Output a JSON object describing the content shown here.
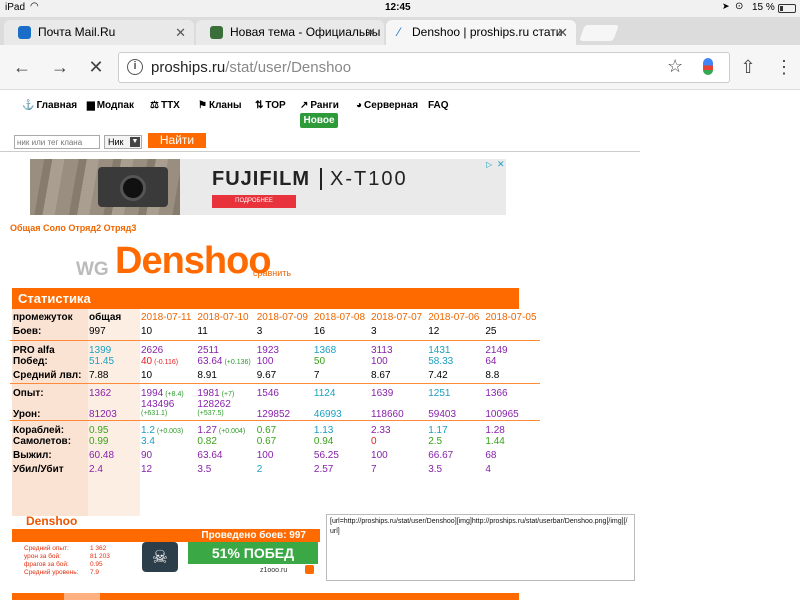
{
  "status": {
    "device": "iPad",
    "time": "12:45",
    "battery": "15 %"
  },
  "tabs": [
    {
      "label": "Почта Mail.Ru",
      "favicon_color": "#1a6ec8"
    },
    {
      "label": "Новая тема - Официальны",
      "favicon_color": "#3a6f3a"
    },
    {
      "label": "Denshoo | proships.ru стати",
      "favicon_color": "#1a6ec8"
    }
  ],
  "url": {
    "domain": "proships.ru",
    "path": "/stat/user/Denshoo"
  },
  "nav": [
    {
      "label": "Главная",
      "icon": "anchor-icon",
      "glyph": "⚓"
    },
    {
      "label": "Модпак",
      "icon": "box-icon",
      "glyph": "▆"
    },
    {
      "label": "ТТХ",
      "icon": "scales-icon",
      "glyph": "⚖"
    },
    {
      "label": "Кланы",
      "icon": "flag-icon",
      "glyph": "⚑"
    },
    {
      "label": "ТОР",
      "icon": "sort-icon",
      "glyph": "⇅"
    },
    {
      "label": "Ранги",
      "icon": "chart-icon",
      "glyph": "↗"
    },
    {
      "label": "Серверная",
      "icon": "pie-icon",
      "glyph": "◕"
    },
    {
      "label": "FAQ",
      "icon": "",
      "glyph": ""
    }
  ],
  "badge_new": "Новое",
  "search": {
    "placeholder": "ник или тег клана",
    "select": "Ник",
    "button": "Найти"
  },
  "ad": {
    "brand": "FUJIFILM",
    "model": "X-T100",
    "cta": "ПОДРОБНЕЕ"
  },
  "subnav": "Общая Соло Отряд2 Отряд3",
  "player": {
    "server": "WG",
    "name": "Denshoo",
    "compare": "сравнить"
  },
  "section_title": "Статистика",
  "colors": {
    "orange": "#ff6a00",
    "purple": "#8822aa",
    "cyan": "#1aa0c0",
    "green": "#3aa21a",
    "red": "#e82020",
    "banner_green": "#39a845"
  },
  "table": {
    "header": [
      "промежуток",
      "общая",
      "2018-07-11",
      "2018-07-10",
      "2018-07-09",
      "2018-07-08",
      "2018-07-07",
      "2018-07-06",
      "2018-07-05"
    ],
    "rows": [
      {
        "label": "Боев:",
        "cells": [
          [
            "997",
            "k",
            ""
          ],
          [
            "10",
            "k",
            ""
          ],
          [
            "11",
            "k",
            ""
          ],
          [
            "3",
            "k",
            ""
          ],
          [
            "16",
            "k",
            ""
          ],
          [
            "3",
            "k",
            ""
          ],
          [
            "12",
            "k",
            ""
          ],
          [
            "25",
            "k",
            ""
          ]
        ]
      },
      {
        "label": "PRO alfa",
        "sep": true,
        "cells": [
          [
            "1399",
            "c",
            ""
          ],
          [
            "2626",
            "p",
            ""
          ],
          [
            "2511",
            "p",
            ""
          ],
          [
            "1923",
            "p",
            ""
          ],
          [
            "1368",
            "c",
            ""
          ],
          [
            "3113",
            "p",
            ""
          ],
          [
            "1431",
            "c",
            ""
          ],
          [
            "2149",
            "p",
            ""
          ]
        ]
      },
      {
        "label": "Побед:",
        "cells": [
          [
            "51.45",
            "c",
            ""
          ],
          [
            "40",
            "r",
            "(-0.116)"
          ],
          [
            "63.64",
            "p",
            "(+0.136)"
          ],
          [
            "100",
            "p",
            ""
          ],
          [
            "50",
            "g",
            ""
          ],
          [
            "100",
            "p",
            ""
          ],
          [
            "58.33",
            "c",
            ""
          ],
          [
            "64",
            "p",
            ""
          ]
        ]
      },
      {
        "label": "Средний лвл:",
        "cells": [
          [
            "7.88",
            "k",
            ""
          ],
          [
            "10",
            "k",
            ""
          ],
          [
            "8.91",
            "k",
            ""
          ],
          [
            "9.67",
            "k",
            ""
          ],
          [
            "7",
            "k",
            ""
          ],
          [
            "8.67",
            "k",
            ""
          ],
          [
            "7.42",
            "k",
            ""
          ],
          [
            "8.8",
            "k",
            ""
          ]
        ]
      },
      {
        "label": "Опыт:",
        "sep": true,
        "cells": [
          [
            "1362",
            "p",
            ""
          ],
          [
            "1994",
            "p",
            "(+8.4)"
          ],
          [
            "1981",
            "p",
            "(+7)"
          ],
          [
            "1546",
            "p",
            ""
          ],
          [
            "1124",
            "c",
            ""
          ],
          [
            "1639",
            "p",
            ""
          ],
          [
            "1251",
            "c",
            ""
          ],
          [
            "1366",
            "p",
            ""
          ]
        ]
      },
      {
        "label": "Урон:",
        "tall": true,
        "cells": [
          [
            "81203",
            "p",
            ""
          ],
          [
            "143496",
            "p",
            "(+631.1)"
          ],
          [
            "128262",
            "p",
            "(+537.5)"
          ],
          [
            "129852",
            "p",
            ""
          ],
          [
            "46993",
            "c",
            ""
          ],
          [
            "118660",
            "p",
            ""
          ],
          [
            "59403",
            "p",
            ""
          ],
          [
            "100965",
            "p",
            ""
          ]
        ]
      },
      {
        "label": "Кораблей:",
        "sep": true,
        "cells": [
          [
            "0.95",
            "g",
            ""
          ],
          [
            "1.2",
            "c",
            "(+0.003)"
          ],
          [
            "1.27",
            "p",
            "(+0.004)"
          ],
          [
            "0.67",
            "g",
            ""
          ],
          [
            "1.13",
            "c",
            ""
          ],
          [
            "2.33",
            "p",
            ""
          ],
          [
            "1.17",
            "c",
            ""
          ],
          [
            "1.28",
            "p",
            ""
          ]
        ]
      },
      {
        "label": "Самолетов:",
        "cells": [
          [
            "0.99",
            "g",
            ""
          ],
          [
            "3.4",
            "c",
            ""
          ],
          [
            "0.82",
            "g",
            ""
          ],
          [
            "0.67",
            "g",
            ""
          ],
          [
            "0.94",
            "g",
            ""
          ],
          [
            "0",
            "r",
            ""
          ],
          [
            "2.5",
            "g",
            ""
          ],
          [
            "1.44",
            "g",
            ""
          ]
        ]
      },
      {
        "label": "Выжил:",
        "cells": [
          [
            "60.48",
            "p",
            ""
          ],
          [
            "90",
            "p",
            ""
          ],
          [
            "63.64",
            "p",
            ""
          ],
          [
            "100",
            "p",
            ""
          ],
          [
            "56.25",
            "p",
            ""
          ],
          [
            "100",
            "p",
            ""
          ],
          [
            "66.67",
            "p",
            ""
          ],
          [
            "68",
            "p",
            ""
          ]
        ]
      },
      {
        "label": "Убил/Убит",
        "cells": [
          [
            "2.4",
            "p",
            ""
          ],
          [
            "12",
            "p",
            ""
          ],
          [
            "3.5",
            "p",
            ""
          ],
          [
            "2",
            "c",
            ""
          ],
          [
            "2.57",
            "p",
            ""
          ],
          [
            "7",
            "p",
            ""
          ],
          [
            "3.5",
            "p",
            ""
          ],
          [
            "4",
            "p",
            ""
          ]
        ]
      }
    ]
  },
  "userbar": {
    "name": "Denshoo",
    "battles": "Проведено боев: 997",
    "wins": "51% ПОБЕД",
    "site": "z1ooo.ru",
    "stats": [
      {
        "label": "Средний опыт:",
        "value": "1 362"
      },
      {
        "label": "урон за бой:",
        "value": "81 203"
      },
      {
        "label": "фрагов за бой:",
        "value": "0.95"
      },
      {
        "label": "Средний уровень:",
        "value": "7.9"
      }
    ]
  },
  "bbcode": "[url=http://proships.ru/stat/user/Denshoo][img]http://proships.ru/stat/userbar/Denshoo.png[/img][/url]"
}
